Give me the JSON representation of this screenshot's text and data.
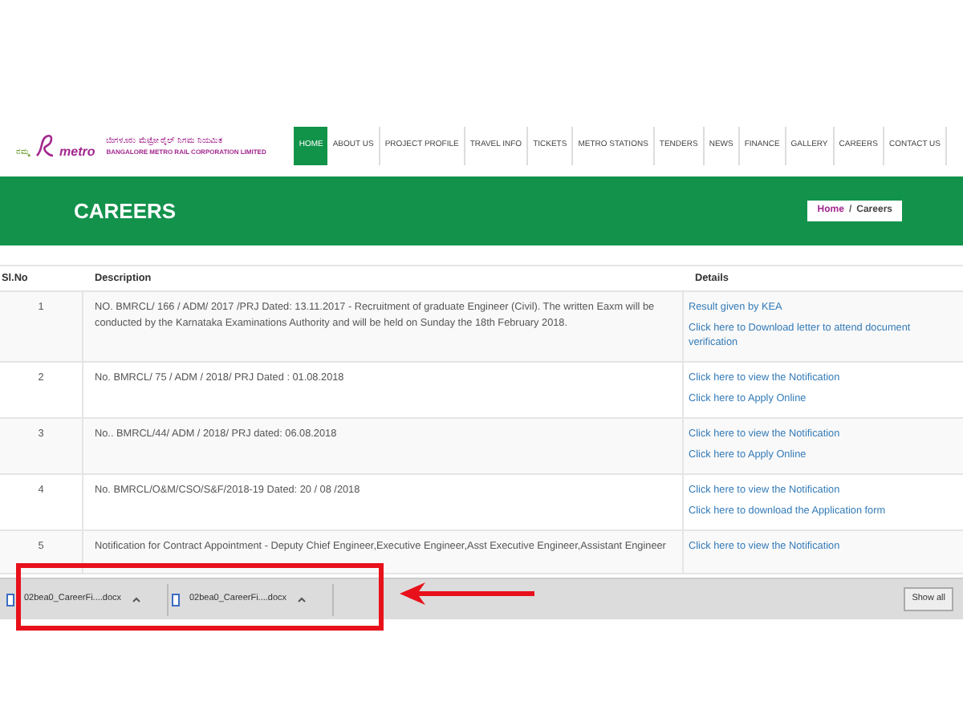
{
  "logo": {
    "small_text": "ನಮ್ಮ",
    "brand": "metro",
    "name_kannada": "ಬೆಂಗಳೂರು ಮೆಟ್ರೋ ರೈಲ್ ನಿಗಮ ನಿಯಮಿತ",
    "name_english": "BANGALORE METRO RAIL CORPORATION LIMITED"
  },
  "nav": [
    {
      "label": "HOME",
      "selected": true
    },
    {
      "label": "ABOUT US",
      "selected": false
    },
    {
      "label": "PROJECT PROFILE",
      "selected": false
    },
    {
      "label": "TRAVEL INFO",
      "selected": false
    },
    {
      "label": "TICKETS",
      "selected": false
    },
    {
      "label": "METRO STATIONS",
      "selected": false
    },
    {
      "label": "TENDERS",
      "selected": false
    },
    {
      "label": "NEWS",
      "selected": false
    },
    {
      "label": "FINANCE",
      "selected": false
    },
    {
      "label": "GALLERY",
      "selected": false
    },
    {
      "label": "CAREERS",
      "selected": false
    },
    {
      "label": "CONTACT US",
      "selected": false
    }
  ],
  "banner": {
    "title": "CAREERS",
    "breadcrumb": [
      "Home",
      "Careers"
    ],
    "separator": "/"
  },
  "table": {
    "columns": [
      "Sl.No",
      "Description",
      "Details"
    ],
    "rows": [
      {
        "no": "1",
        "description": "NO. BMRCL/ 166 / ADM/ 2017 /PRJ Dated: 13.11.2017 - Recruitment of graduate Engineer (Civil). The written Eaxm will be conducted by the Karnataka Examinations Authority and will be held on Sunday the 18th February 2018.",
        "links": [
          "Result given by KEA",
          "Click here to Download letter to attend document verification"
        ]
      },
      {
        "no": "2",
        "description": "No. BMRCL/ 75 / ADM / 2018/ PRJ Dated : 01.08.2018",
        "links": [
          "Click here to view the Notification",
          "Click here to Apply Online"
        ]
      },
      {
        "no": "3",
        "description": "No.. BMRCL/44/ ADM / 2018/ PRJ dated: 06.08.2018",
        "links": [
          "Click here to view the Notification",
          "Click here to Apply Online"
        ]
      },
      {
        "no": "4",
        "description": "No. BMRCL/O&M/CSO/S&F/2018-19 Dated: 20 / 08 /2018",
        "links": [
          "Click here to view the Notification",
          "Click here to download the Application form"
        ]
      },
      {
        "no": "5",
        "description": "Notification for Contract Appointment - Deputy Chief Engineer,Executive Engineer,Asst Executive Engineer,Assistant Engineer",
        "links": [
          "Click here to view the Notification"
        ]
      }
    ]
  },
  "downloads": {
    "items": [
      {
        "name": "02bea0_CareerFi....docx"
      },
      {
        "name": "02bea0_CareerFi....docx"
      }
    ],
    "show_all": "Show all"
  }
}
